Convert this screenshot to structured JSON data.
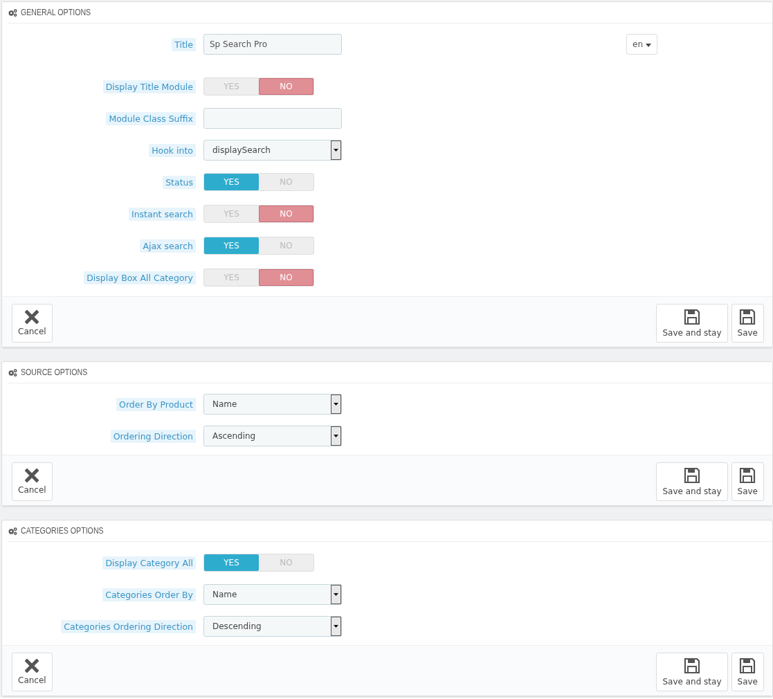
{
  "panels": [
    {
      "title": "GENERAL OPTIONS",
      "fields": [
        {
          "kind": "text",
          "label": "Title",
          "value": "Sp Search Pro",
          "language": "en"
        },
        {
          "kind": "switch",
          "label": "Display Title Module",
          "options": [
            {
              "label": "YES",
              "selected": false
            },
            {
              "label": "NO",
              "selected": true
            }
          ]
        },
        {
          "kind": "text",
          "label": "Module Class Suffix"
        },
        {
          "kind": "select",
          "label": "Hook into",
          "value": "displaySearch"
        },
        {
          "kind": "switch",
          "label": "Status",
          "options": [
            {
              "label": "YES",
              "selected": true
            },
            {
              "label": "NO",
              "selected": false
            }
          ]
        },
        {
          "kind": "switch",
          "label": "Instant search",
          "options": [
            {
              "label": "YES",
              "selected": false
            },
            {
              "label": "NO",
              "selected": true
            }
          ]
        },
        {
          "kind": "switch",
          "label": "Ajax search",
          "options": [
            {
              "label": "YES",
              "selected": true
            },
            {
              "label": "NO",
              "selected": false
            }
          ]
        },
        {
          "kind": "switch",
          "label": "Display Box All Category",
          "options": [
            {
              "label": "YES",
              "selected": false
            },
            {
              "label": "NO",
              "selected": true
            }
          ]
        }
      ],
      "buttons": [
        {
          "kind": "cancel",
          "label": "Cancel"
        },
        {
          "kind": "save",
          "label": "Save and stay"
        },
        {
          "kind": "save",
          "label": "Save"
        }
      ]
    },
    {
      "title": "SOURCE OPTIONS",
      "fields": [
        {
          "kind": "select",
          "label": "Order By Product",
          "value": "Name"
        },
        {
          "kind": "select",
          "label": "Ordering Direction",
          "value": "Ascending"
        }
      ],
      "buttons": [
        {
          "kind": "cancel",
          "label": "Cancel"
        },
        {
          "kind": "save",
          "label": "Save and stay"
        },
        {
          "kind": "save",
          "label": "Save"
        }
      ]
    },
    {
      "title": "CATEGORIES OPTIONS",
      "fields": [
        {
          "kind": "switch",
          "label": "Display Category All",
          "options": [
            {
              "label": "YES",
              "selected": true
            },
            {
              "label": "NO",
              "selected": false
            }
          ]
        },
        {
          "kind": "select",
          "label": "Categories Order By",
          "value": "Name"
        },
        {
          "kind": "select",
          "label": "Categories Ordering Direction",
          "value": "Descending"
        }
      ],
      "buttons": [
        {
          "kind": "cancel",
          "label": "Cancel"
        },
        {
          "kind": "save",
          "label": "Save and stay"
        },
        {
          "kind": "save",
          "label": "Save"
        }
      ]
    }
  ]
}
